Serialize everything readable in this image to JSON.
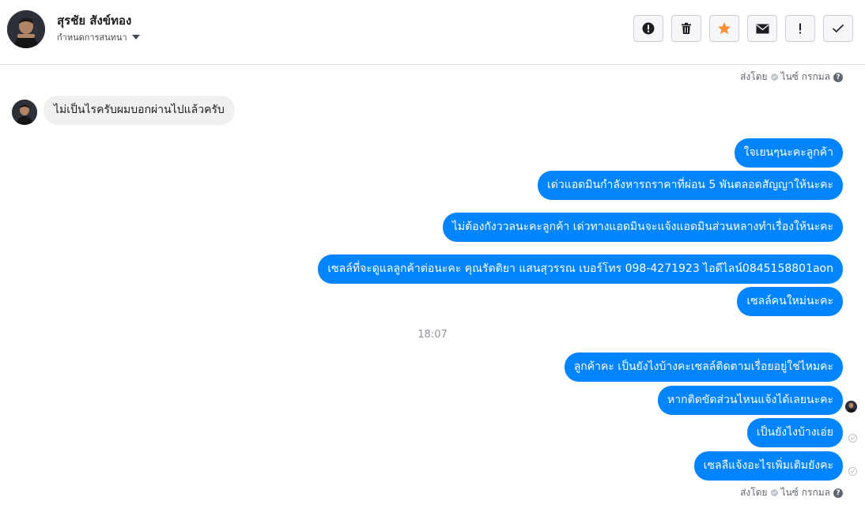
{
  "header": {
    "name": "สุรชัย สังข์ทอง",
    "subtitle": "กำหนดการสนทนา"
  },
  "toolbar": {
    "buttons": [
      {
        "icon": "alert-circle-icon"
      },
      {
        "icon": "trash-icon"
      },
      {
        "icon": "star-icon",
        "color": "#f7923b"
      },
      {
        "icon": "envelope-icon"
      },
      {
        "icon": "exclamation-icon"
      },
      {
        "icon": "check-icon"
      }
    ]
  },
  "meta_top": {
    "sent_by": "ส่งโดย",
    "agent": "ไนซ์ กรกมล"
  },
  "meta_bottom": {
    "sent_by": "ส่งโดย",
    "agent": "ไนซ์ กรกมล"
  },
  "incoming": {
    "text": "ไม่เป็นไรครับผมบอกผ่านไปแล้วครับ"
  },
  "outgoing_1": [
    "ใจเยนๆนะคะลูกค้า",
    "เด่วแอดมินกำลังหารถราคาที่ผ่อน 5 พันตลอดสัญญาให้นะคะ",
    "ไม่ต้องกังววลนะคะลูกค้า เด่วทางแอดมินจะแจ้งแอดมินส่วนหลางทำเรื่องให้นะคะ",
    "เซลล์ที่จะดูแลลูกค้าต่อนะคะ คุณรัตติยา แสนสุวรรณ    เบอร์โทร 098-4271923 ไอดีไลน์0845158801aon",
    "เซลล์คนใหม่นะคะ"
  ],
  "timestamp": "18:07",
  "outgoing_2": [
    "ลูกค้าคะ เป็นยังไงบ้างคะเซลล์ติดตามเรื่อยอยู่ใช่ไหมคะ",
    "หากติดขัดส่วนไหนแจ้งได้เลยนะคะ",
    "เป็นยังไงบ้างเอ่ย",
    "เซลลืแจ้งอะไรเพิ่มเติมยังคะ"
  ],
  "colors": {
    "accent": "#0084ff",
    "incoming_bubble": "#f1f0f0"
  }
}
